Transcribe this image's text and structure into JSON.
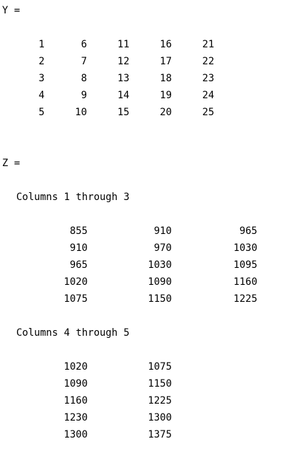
{
  "y_matrix": {
    "label": "Y =",
    "rows": [
      [
        "1",
        "6",
        "11",
        "16",
        "21"
      ],
      [
        "2",
        "7",
        "12",
        "17",
        "22"
      ],
      [
        "3",
        "8",
        "13",
        "18",
        "23"
      ],
      [
        "4",
        "9",
        "14",
        "19",
        "24"
      ],
      [
        "5",
        "10",
        "15",
        "20",
        "25"
      ]
    ]
  },
  "z_matrix": {
    "label": "Z =",
    "blocks": [
      {
        "heading": "Columns 1 through 3",
        "rows": [
          [
            "855",
            "910",
            "965"
          ],
          [
            "910",
            "970",
            "1030"
          ],
          [
            "965",
            "1030",
            "1095"
          ],
          [
            "1020",
            "1090",
            "1160"
          ],
          [
            "1075",
            "1150",
            "1225"
          ]
        ]
      },
      {
        "heading": "Columns 4 through 5",
        "rows": [
          [
            "1020",
            "1075"
          ],
          [
            "1090",
            "1150"
          ],
          [
            "1160",
            "1225"
          ],
          [
            "1230",
            "1300"
          ],
          [
            "1300",
            "1375"
          ]
        ]
      }
    ]
  }
}
